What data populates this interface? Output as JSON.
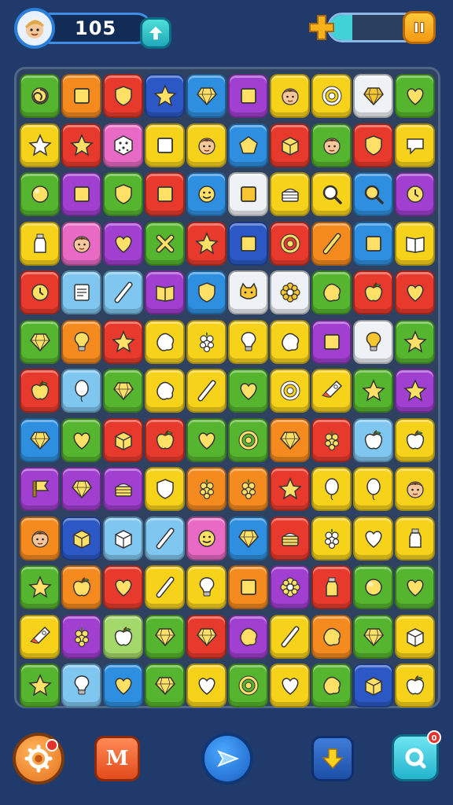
{
  "header": {
    "score": "105",
    "energy_level": 0.22
  },
  "colors": {
    "background": "#1f3a6b",
    "red": "#e83a2c",
    "orange": "#f58a1f",
    "yellow": "#f7d21b",
    "green": "#55b52e",
    "blue": "#2e8fe0",
    "purple": "#a03fd0",
    "pink": "#e86ac5",
    "white": "#eef1f5",
    "lightblue": "#7fc6f0",
    "lightgreen": "#a4d86a",
    "darkblue": "#2b58c4"
  },
  "bottom_bar": {
    "map_label": "M",
    "search_badge": "0",
    "buttons": [
      "settings",
      "map",
      "play",
      "download",
      "search"
    ]
  },
  "board": {
    "rows": [
      [
        [
          "green",
          "swirl"
        ],
        [
          "orange",
          "square"
        ],
        [
          "red",
          "shield"
        ],
        [
          "darkblue",
          "star"
        ],
        [
          "blue",
          "gem"
        ],
        [
          "purple",
          "square"
        ],
        [
          "yellow",
          "face"
        ],
        [
          "yellow",
          "ring"
        ],
        [
          "white",
          "gem"
        ],
        [
          "green",
          "heart"
        ]
      ],
      [
        [
          "yellow",
          "star"
        ],
        [
          "red",
          "star"
        ],
        [
          "pink",
          "dice"
        ],
        [
          "yellow",
          "square"
        ],
        [
          "yellow",
          "face"
        ],
        [
          "blue",
          "pentagon"
        ],
        [
          "red",
          "box"
        ],
        [
          "green",
          "face"
        ],
        [
          "red",
          "shield"
        ],
        [
          "yellow",
          "bubble"
        ]
      ],
      [
        [
          "green",
          "ball"
        ],
        [
          "purple",
          "square"
        ],
        [
          "green",
          "shield"
        ],
        [
          "red",
          "square"
        ],
        [
          "blue",
          "smiley"
        ],
        [
          "white",
          "square"
        ],
        [
          "yellow",
          "cake"
        ],
        [
          "yellow",
          "magnifier"
        ],
        [
          "blue",
          "magnifier"
        ],
        [
          "purple",
          "clock"
        ]
      ],
      [
        [
          "yellow",
          "bottle"
        ],
        [
          "pink",
          "face"
        ],
        [
          "purple",
          "heart"
        ],
        [
          "green",
          "cross"
        ],
        [
          "red",
          "star"
        ],
        [
          "darkblue",
          "square"
        ],
        [
          "red",
          "ring"
        ],
        [
          "orange",
          "stick"
        ],
        [
          "blue",
          "square"
        ],
        [
          "yellow",
          "book"
        ]
      ],
      [
        [
          "red",
          "clock"
        ],
        [
          "lightblue",
          "note"
        ],
        [
          "lightblue",
          "stick"
        ],
        [
          "purple",
          "book"
        ],
        [
          "blue",
          "shield"
        ],
        [
          "white",
          "cat"
        ],
        [
          "white",
          "flower"
        ],
        [
          "green",
          "blob"
        ],
        [
          "red",
          "apple"
        ],
        [
          "red",
          "heart"
        ]
      ],
      [
        [
          "green",
          "gem"
        ],
        [
          "orange",
          "bulb"
        ],
        [
          "red",
          "star"
        ],
        [
          "yellow",
          "blob"
        ],
        [
          "yellow",
          "grape"
        ],
        [
          "yellow",
          "bulb"
        ],
        [
          "yellow",
          "blob"
        ],
        [
          "purple",
          "square"
        ],
        [
          "white",
          "bulb"
        ],
        [
          "green",
          "star"
        ]
      ],
      [
        [
          "red",
          "apple"
        ],
        [
          "lightblue",
          "balloon"
        ],
        [
          "green",
          "gem"
        ],
        [
          "yellow",
          "blob"
        ],
        [
          "yellow",
          "stick"
        ],
        [
          "green",
          "heart"
        ],
        [
          "yellow",
          "ring"
        ],
        [
          "yellow",
          "rocket"
        ],
        [
          "green",
          "star"
        ],
        [
          "purple",
          "star"
        ]
      ],
      [
        [
          "blue",
          "gem"
        ],
        [
          "green",
          "heart"
        ],
        [
          "red",
          "box"
        ],
        [
          "red",
          "apple"
        ],
        [
          "green",
          "heart"
        ],
        [
          "green",
          "ring"
        ],
        [
          "orange",
          "gem"
        ],
        [
          "red",
          "grape"
        ],
        [
          "lightblue",
          "apple"
        ],
        [
          "yellow",
          "apple"
        ]
      ],
      [
        [
          "purple",
          "flag"
        ],
        [
          "purple",
          "gem"
        ],
        [
          "purple",
          "cake"
        ],
        [
          "yellow",
          "shield"
        ],
        [
          "orange",
          "grape"
        ],
        [
          "orange",
          "grape"
        ],
        [
          "red",
          "star"
        ],
        [
          "yellow",
          "balloon"
        ],
        [
          "yellow",
          "balloon"
        ],
        [
          "yellow",
          "face"
        ]
      ],
      [
        [
          "orange",
          "face"
        ],
        [
          "darkblue",
          "box"
        ],
        [
          "lightblue",
          "box"
        ],
        [
          "lightblue",
          "stick"
        ],
        [
          "pink",
          "smiley"
        ],
        [
          "blue",
          "gem"
        ],
        [
          "red",
          "cake"
        ],
        [
          "yellow",
          "grape"
        ],
        [
          "yellow",
          "heart"
        ],
        [
          "yellow",
          "bottle"
        ]
      ],
      [
        [
          "green",
          "star"
        ],
        [
          "orange",
          "apple"
        ],
        [
          "red",
          "heart"
        ],
        [
          "yellow",
          "stick"
        ],
        [
          "yellow",
          "bulb"
        ],
        [
          "orange",
          "square"
        ],
        [
          "purple",
          "flower"
        ],
        [
          "red",
          "bottle"
        ],
        [
          "green",
          "ball"
        ],
        [
          "green",
          "heart"
        ]
      ],
      [
        [
          "yellow",
          "rocket"
        ],
        [
          "purple",
          "grape"
        ],
        [
          "lightgreen",
          "apple"
        ],
        [
          "green",
          "gem"
        ],
        [
          "red",
          "gem"
        ],
        [
          "purple",
          "blob"
        ],
        [
          "yellow",
          "stick"
        ],
        [
          "orange",
          "blob"
        ],
        [
          "green",
          "gem"
        ],
        [
          "yellow",
          "box"
        ]
      ],
      [
        [
          "green",
          "star"
        ],
        [
          "lightblue",
          "bulb"
        ],
        [
          "blue",
          "heart"
        ],
        [
          "green",
          "gem"
        ],
        [
          "yellow",
          "heart"
        ],
        [
          "green",
          "ring"
        ],
        [
          "yellow",
          "heart"
        ],
        [
          "green",
          "blob"
        ],
        [
          "darkblue",
          "box"
        ],
        [
          "yellow",
          "apple"
        ]
      ]
    ]
  }
}
